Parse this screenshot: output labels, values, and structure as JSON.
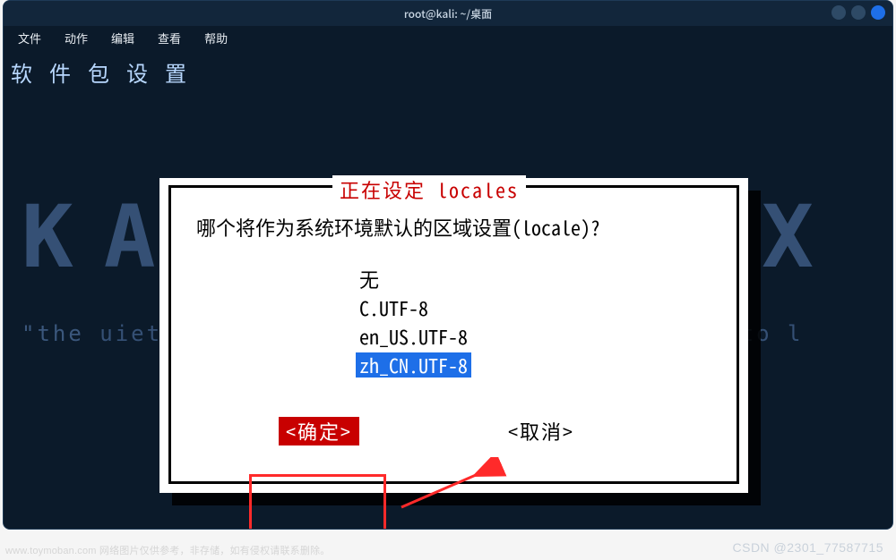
{
  "window": {
    "title": "root@kali: ~/桌面"
  },
  "menu": {
    "file": "文件",
    "action": "动作",
    "edit": "编辑",
    "view": "查看",
    "help": "帮助"
  },
  "terminal": {
    "heading": "软件包设置",
    "bg_big": "KALI LINUX",
    "bg_tag_pre": "\"the ",
    "bg_tag_mid": "uieter you become, the more you are able to l",
    "bg_tag_post": ""
  },
  "dialog": {
    "title": "正在设定 locales",
    "question": "哪个将作为系统环境默认的区域设置(locale)?",
    "choices": {
      "c0": "无",
      "c1": "C.UTF-8",
      "c2": "en_US.UTF-8",
      "c3": "zh_CN.UTF-8"
    },
    "selected_index": 3,
    "ok_label": "<确定>",
    "cancel_label": "<取消>"
  },
  "watermark": "CSDN @2301_77587715",
  "footer_ghost": "www.toymoban.com 网络图片仅供参考，非存储，如有侵权请联系删除。"
}
